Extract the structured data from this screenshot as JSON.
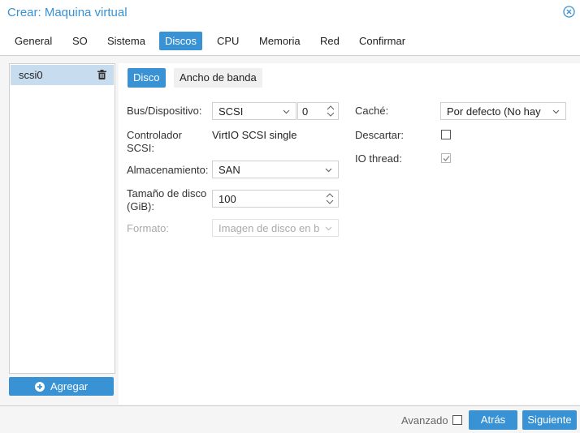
{
  "window": {
    "title": "Crear: Maquina virtual",
    "close_icon": "close-icon"
  },
  "tabs": [
    {
      "label": "General"
    },
    {
      "label": "SO"
    },
    {
      "label": "Sistema"
    },
    {
      "label": "Discos",
      "active": true
    },
    {
      "label": "CPU"
    },
    {
      "label": "Memoria"
    },
    {
      "label": "Red"
    },
    {
      "label": "Confirmar"
    }
  ],
  "disk_list": {
    "items": [
      {
        "label": "scsi0",
        "selected": true,
        "icon": "trash-icon"
      }
    ],
    "add_button": {
      "label": "Agregar",
      "icon": "plus-circle-icon"
    }
  },
  "subtabs": [
    {
      "label": "Disco",
      "active": true
    },
    {
      "label": "Ancho de banda"
    }
  ],
  "form": {
    "bus_label": "Bus/Dispositivo:",
    "bus_value": "SCSI",
    "device_value": "0",
    "controller_label_line1": "Controlador",
    "controller_label_line2": "SCSI:",
    "controller_value": "VirtIO SCSI single",
    "storage_label": "Almacenamiento:",
    "storage_value": "SAN",
    "size_label_line1": "Tamaño de disco",
    "size_label_line2": "(GiB):",
    "size_value": "100",
    "format_label": "Formato:",
    "format_value": "Imagen de disco en b",
    "cache_label": "Caché:",
    "cache_value": "Por defecto (No hay",
    "discard_label": "Descartar:",
    "discard_checked": false,
    "iothread_label": "IO thread:",
    "iothread_checked": true
  },
  "footer": {
    "advanced_label": "Avanzado",
    "advanced_checked": false,
    "back_label": "Atrás",
    "next_label": "Siguiente"
  },
  "colors": {
    "accent": "#3892d4",
    "selected_row": "#c8dcf0",
    "panel_bg": "#f5f5f5"
  }
}
